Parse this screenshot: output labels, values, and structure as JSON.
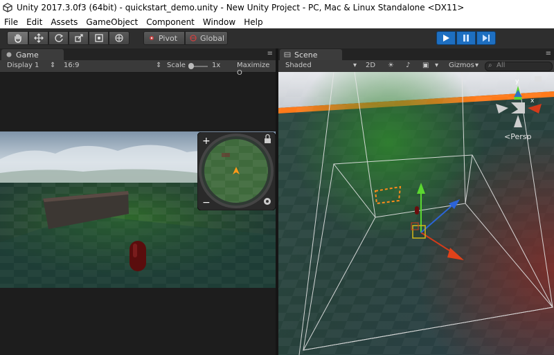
{
  "window": {
    "title": "Unity 2017.3.0f3 (64bit) - quickstart_demo.unity - New Unity Project - PC, Mac & Linux Standalone <DX11>"
  },
  "menu": [
    "File",
    "Edit",
    "Assets",
    "GameObject",
    "Component",
    "Window",
    "Help"
  ],
  "toolbar": {
    "pivot": "Pivot",
    "global": "Global"
  },
  "game": {
    "tab": "Game",
    "display": "Display 1",
    "aspect": "16:9",
    "scale_label": "Scale",
    "scale_value": "1x",
    "maximize": "Maximize O"
  },
  "scene": {
    "tab": "Scene",
    "shading": "Shaded",
    "mode2d": "2D",
    "gizmos": "Gizmos",
    "search_placeholder": "All",
    "persp": "Persp"
  },
  "colors": {
    "play_accent": "#1e6fc1",
    "selection_orange": "#ff8c1a"
  }
}
